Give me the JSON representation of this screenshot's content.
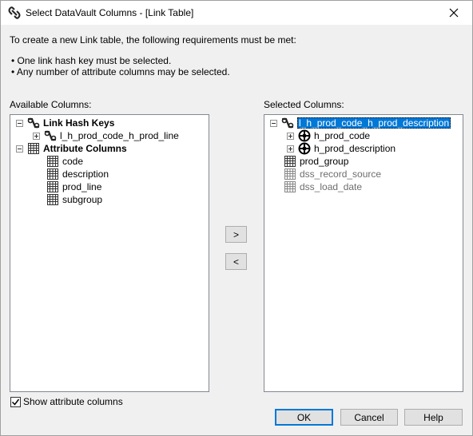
{
  "window": {
    "title": "Select DataVault Columns - [Link Table]"
  },
  "intro": {
    "line1": "To create a new Link table, the following requirements must be met:",
    "req1": "• One link hash key must be selected.",
    "req2": "• Any number of attribute columns may be selected."
  },
  "available": {
    "label": "Available Columns:",
    "group1": "Link Hash Keys",
    "key1": "l_h_prod_code_h_prod_line",
    "group2": "Attribute Columns",
    "attr1": "code",
    "attr2": "description",
    "attr3": "prod_line",
    "attr4": "subgroup"
  },
  "selected": {
    "label": "Selected Columns:",
    "root": "l_h_prod_code_h_prod_description",
    "hub1": "h_prod_code",
    "hub2": "h_prod_description",
    "col1": "prod_group",
    "col2": "dss_record_source",
    "col3": "dss_load_date"
  },
  "buttons": {
    "add": ">",
    "remove": "<",
    "ok": "OK",
    "cancel": "Cancel",
    "help": "Help"
  },
  "options": {
    "show_attr": "Show attribute columns",
    "show_attr_checked": true
  },
  "colors": {
    "selection": "#0078d7",
    "panel_border": "#828790",
    "dialog_bg": "#f0f0f0"
  }
}
